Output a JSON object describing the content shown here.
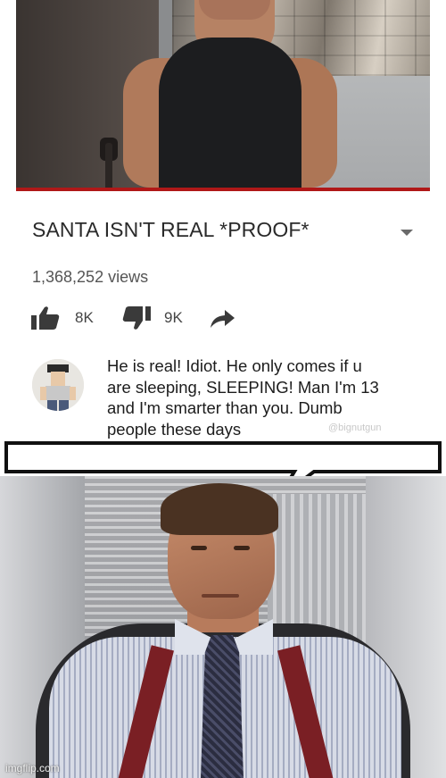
{
  "video": {
    "title": "SANTA ISN'T REAL *PROOF*",
    "views": "1,368,252 views",
    "likes": "8K",
    "dislikes": "9K"
  },
  "comment": {
    "lines": [
      "He is real! Idiot. He only comes if u",
      "are sleeping, SLEEPING! Man I'm 13",
      "and I'm smarter than you. Dumb",
      "people these days"
    ],
    "watermark": "@bignutgun"
  },
  "speech_bubble": {
    "text": ""
  },
  "footer": {
    "imgflip": "imgflip.com"
  },
  "icons": {
    "like": "thumbs-up-icon",
    "dislike": "thumbs-down-icon",
    "share": "share-arrow-icon",
    "menu": "chevron-down-icon"
  },
  "colors": {
    "progress_bar": "#b01818",
    "title_text": "#2a2a2a",
    "meta_text": "#555555"
  }
}
